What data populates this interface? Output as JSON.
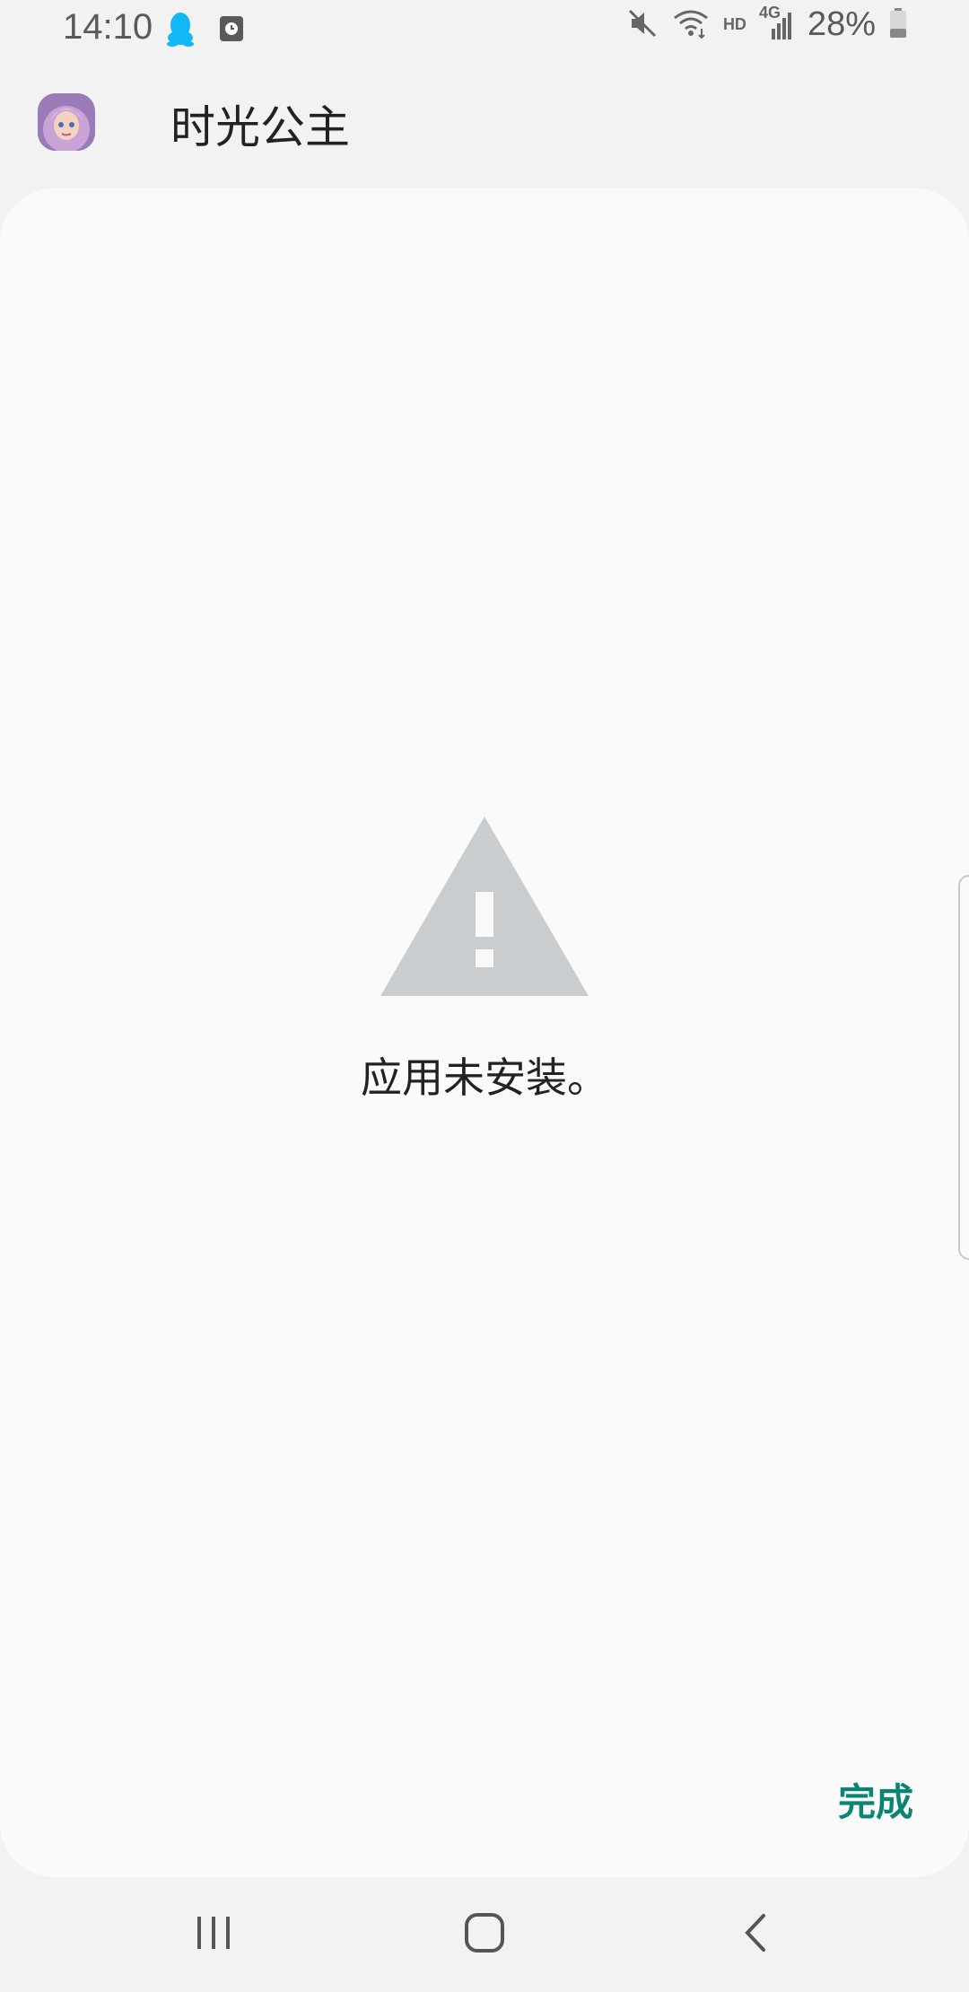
{
  "status_bar": {
    "time": "14:10",
    "battery_percent_text": "28%",
    "hd_label": "HD",
    "network_label": "4G",
    "left_icons": [
      "qq-penguin-icon",
      "screen-record-icon"
    ],
    "right_icons": [
      "mute-icon",
      "wifi-icon",
      "signal-icon",
      "battery-icon"
    ]
  },
  "app_header": {
    "title": "时光公主",
    "avatar_icon": "app-icon-princess"
  },
  "dialog": {
    "icon": "warning-icon",
    "message": "应用未安装。",
    "done_label": "完成"
  },
  "nav_bar": {
    "items": [
      "recent-apps-icon",
      "home-icon",
      "back-icon"
    ]
  },
  "colors": {
    "accent": "#0a8574",
    "card_background": "#fafafa",
    "screen_background": "#f2f2f2",
    "warning_gray": "#c9cdd0",
    "qq_blue": "#12b7f5"
  }
}
